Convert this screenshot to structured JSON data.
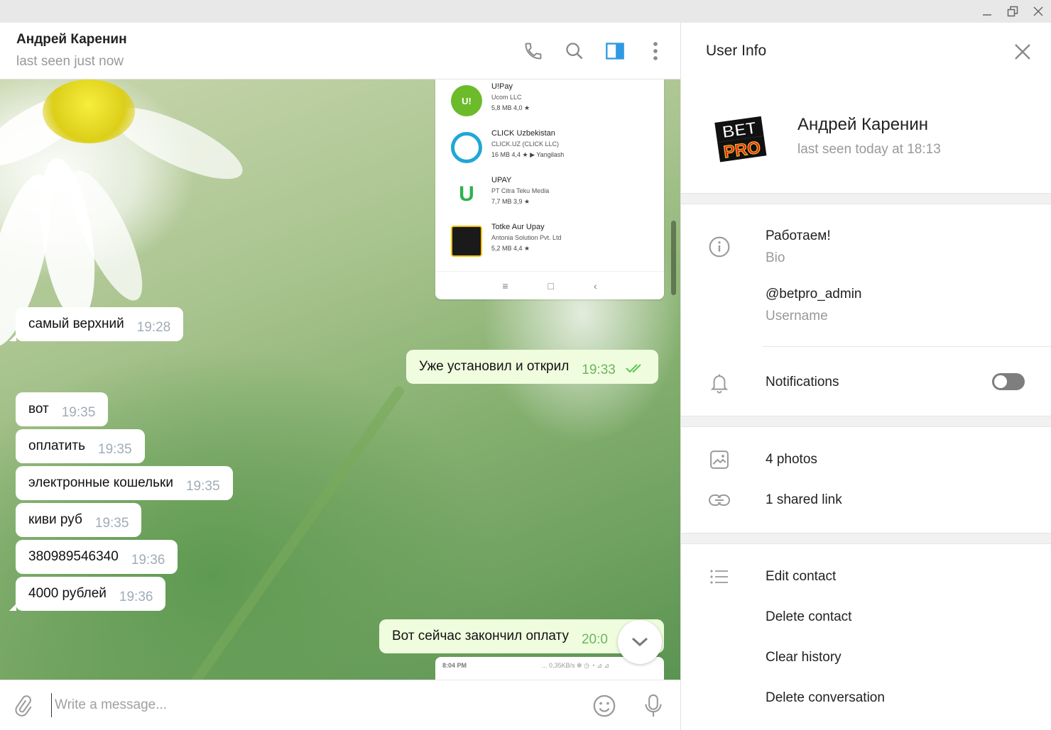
{
  "chat": {
    "name": "Андрей Каренин",
    "status": "last seen just now",
    "shot_apps": [
      {
        "name": "U!Pay",
        "sub": "Ucom LLC",
        "meta": "5,8 MB   4,0 ★"
      },
      {
        "name": "CLICK Uzbekistan",
        "sub": "CLICK.UZ (CLICK LLC)",
        "meta": "16 MB   4,4 ★   ▶ Yangilash"
      },
      {
        "name": "UPAY",
        "sub": "PT Citra Teku Media",
        "meta": "7,7 MB   3,9 ★"
      },
      {
        "name": "Totke Aur Upay",
        "sub": "Antonia Solution Pvt. Ltd",
        "meta": "5,2 MB   4,4 ★"
      }
    ],
    "shot2_time": "8:04 PM",
    "shot2_status": "... 0,35KB/s ✻ ◷ ◔ ⊿ ⊿",
    "messages": [
      {
        "text": "самый верхний",
        "time": "19:28"
      },
      {
        "text": "Уже установил и открил",
        "time": "19:33"
      },
      {
        "text": "вот",
        "time": "19:35"
      },
      {
        "text": "оплатить",
        "time": "19:35"
      },
      {
        "text": "электронные кошельки",
        "time": "19:35"
      },
      {
        "text": "киви руб",
        "time": "19:35"
      },
      {
        "text": "380989546340",
        "time": "19:36"
      },
      {
        "text": "4000 рублей",
        "time": "19:36"
      },
      {
        "text": "Вот сейчас закончил оплату",
        "time": "20:0"
      }
    ],
    "composer_placeholder": "Write a message..."
  },
  "panel": {
    "title": "User Info",
    "name": "Андрей Каренин",
    "status": "last seen today at 18:13",
    "avatar_text": "BET PRO",
    "bio": "Работаем!",
    "bio_label": "Bio",
    "username": "@betpro_admin",
    "username_label": "Username",
    "notifications": "Notifications",
    "photos": "4 photos",
    "links": "1 shared link",
    "actions": [
      "Edit contact",
      "Delete contact",
      "Clear history",
      "Delete conversation"
    ]
  },
  "colors": {
    "accent": "#2f9ae3",
    "outgoing_bubble": "#effdde",
    "read_check": "#5dc452"
  }
}
